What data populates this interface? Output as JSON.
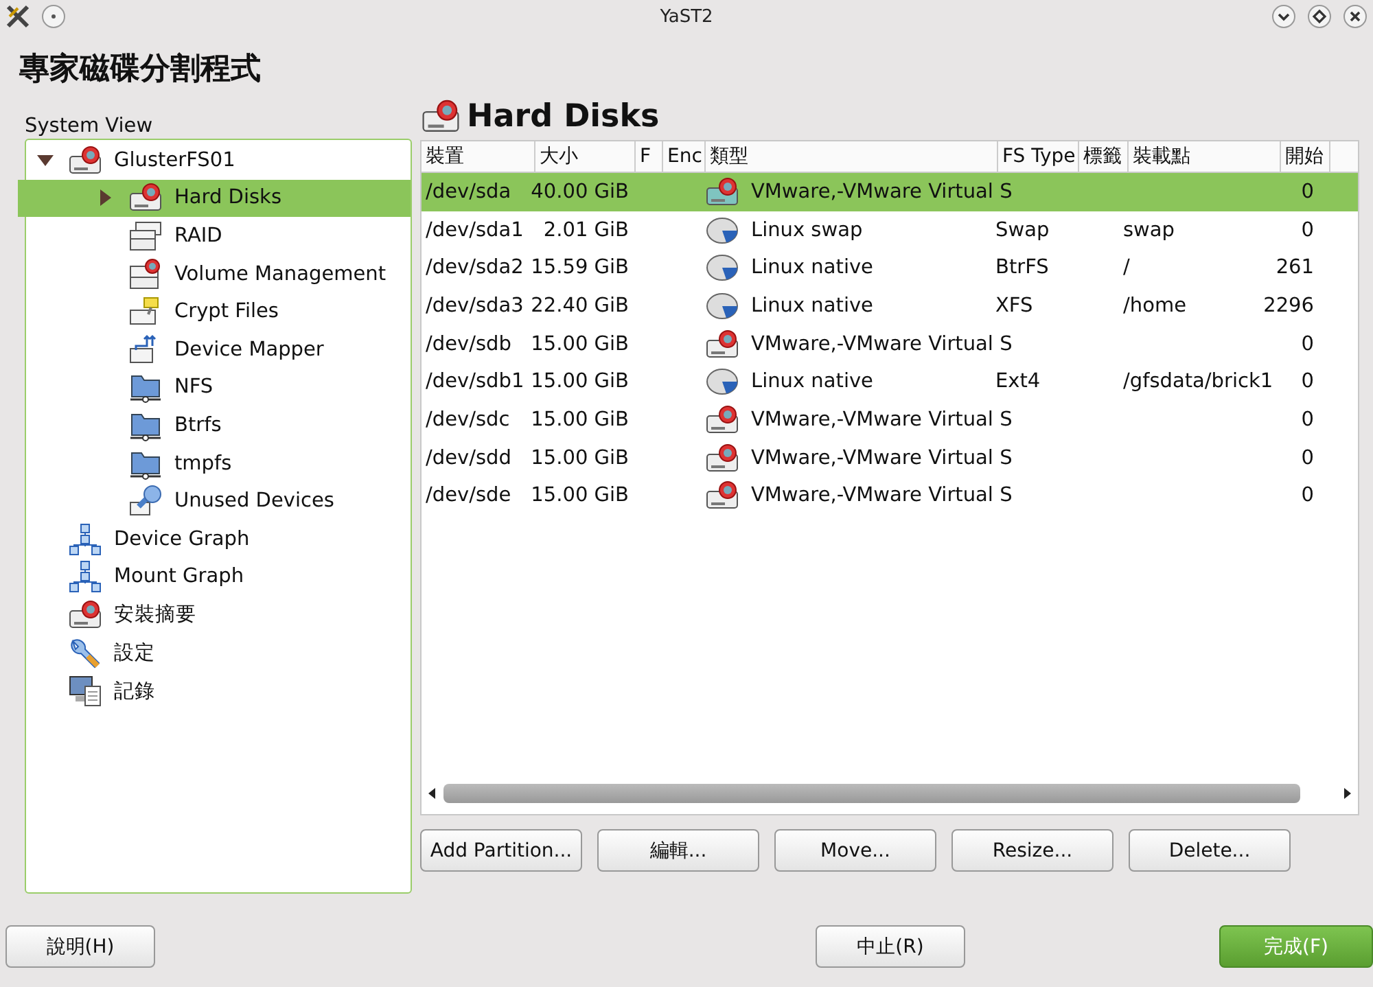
{
  "window": {
    "title": "YaST2"
  },
  "heading": "專家磁碟分割程式",
  "system_view": {
    "label": "System View",
    "tree": [
      {
        "label": "GlusterFS01",
        "kind": "disk",
        "selected": false,
        "expanded": true,
        "children": [
          {
            "label": "Hard Disks",
            "kind": "disk",
            "selected": true,
            "expanded": false
          },
          {
            "label": "RAID",
            "kind": "raid",
            "selected": false
          },
          {
            "label": "Volume Management",
            "kind": "lvm",
            "selected": false
          },
          {
            "label": "Crypt Files",
            "kind": "crypt",
            "selected": false
          },
          {
            "label": "Device Mapper",
            "kind": "mapper",
            "selected": false
          },
          {
            "label": "NFS",
            "kind": "folder",
            "selected": false
          },
          {
            "label": "Btrfs",
            "kind": "folder",
            "selected": false
          },
          {
            "label": "tmpfs",
            "kind": "folder",
            "selected": false
          },
          {
            "label": "Unused Devices",
            "kind": "unused",
            "selected": false
          }
        ]
      },
      {
        "label": "Device Graph",
        "kind": "graph",
        "selected": false
      },
      {
        "label": "Mount Graph",
        "kind": "graph",
        "selected": false
      },
      {
        "label": "安裝摘要",
        "kind": "disk",
        "selected": false
      },
      {
        "label": "設定",
        "kind": "wrench",
        "selected": false
      },
      {
        "label": "記錄",
        "kind": "monitor",
        "selected": false
      }
    ]
  },
  "content": {
    "title": "Hard Disks",
    "table": {
      "columns": [
        "裝置",
        "大小",
        "F",
        "Enc",
        "類型",
        "FS Type",
        "標籤",
        "裝載點",
        "開始"
      ],
      "rows": [
        {
          "kind": "disk",
          "selected": true,
          "cells": [
            "/dev/sda",
            "40.00 GiB",
            "",
            "",
            "VMware,-VMware Virtual S",
            "",
            "",
            "",
            "0"
          ]
        },
        {
          "kind": "partition",
          "selected": false,
          "cells": [
            "/dev/sda1",
            "2.01 GiB",
            "",
            "",
            "Linux swap",
            "Swap",
            "",
            "swap",
            "0"
          ]
        },
        {
          "kind": "partition",
          "selected": false,
          "cells": [
            "/dev/sda2",
            "15.59 GiB",
            "",
            "",
            "Linux native",
            "BtrFS",
            "",
            "/",
            "261"
          ]
        },
        {
          "kind": "partition",
          "selected": false,
          "cells": [
            "/dev/sda3",
            "22.40 GiB",
            "",
            "",
            "Linux native",
            "XFS",
            "",
            "/home",
            "2296"
          ]
        },
        {
          "kind": "disk",
          "selected": false,
          "cells": [
            "/dev/sdb",
            "15.00 GiB",
            "",
            "",
            "VMware,-VMware Virtual S",
            "",
            "",
            "",
            "0"
          ]
        },
        {
          "kind": "partition",
          "selected": false,
          "cells": [
            "/dev/sdb1",
            "15.00 GiB",
            "",
            "",
            "Linux native",
            "Ext4",
            "",
            "/gfsdata/brick1",
            "0"
          ]
        },
        {
          "kind": "disk",
          "selected": false,
          "cells": [
            "/dev/sdc",
            "15.00 GiB",
            "",
            "",
            "VMware,-VMware Virtual S",
            "",
            "",
            "",
            "0"
          ]
        },
        {
          "kind": "disk",
          "selected": false,
          "cells": [
            "/dev/sdd",
            "15.00 GiB",
            "",
            "",
            "VMware,-VMware Virtual S",
            "",
            "",
            "",
            "0"
          ]
        },
        {
          "kind": "disk",
          "selected": false,
          "cells": [
            "/dev/sde",
            "15.00 GiB",
            "",
            "",
            "VMware,-VMware Virtual S",
            "",
            "",
            "",
            "0"
          ]
        }
      ]
    },
    "buttons": [
      "Add Partition...",
      "編輯...",
      "Move...",
      "Resize...",
      "Delete..."
    ]
  },
  "footer": [
    {
      "label": "說明(H)",
      "kind": "normal"
    },
    {
      "label": "中止(R)",
      "kind": "normal"
    },
    {
      "label": "完成(F)",
      "kind": "primary"
    }
  ]
}
